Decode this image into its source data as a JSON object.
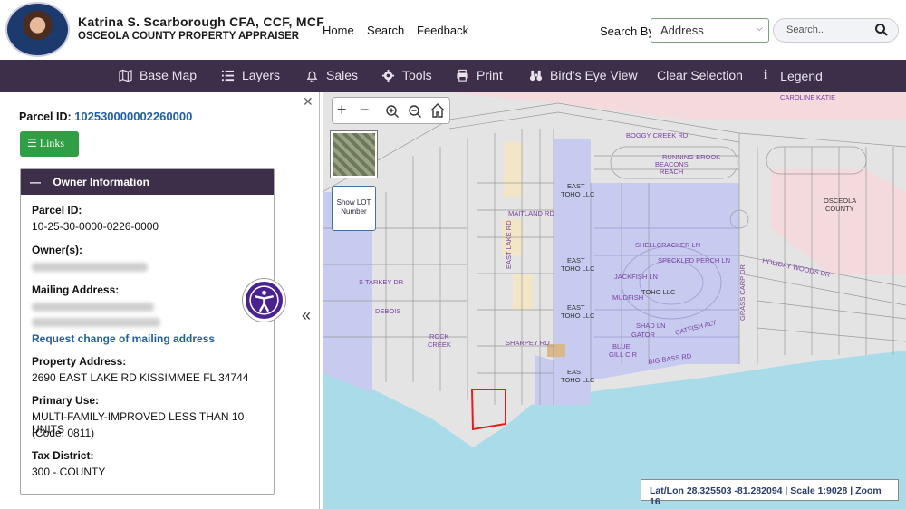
{
  "header": {
    "name": "Katrina S. Scarborough CFA, CCF, MCF",
    "office": "OSCEOLA COUNTY PROPERTY APPRAISER",
    "nav": [
      "Home",
      "Search",
      "Feedback"
    ],
    "search_by_label": "Search By",
    "search_by_value": "Address",
    "search_placeholder": "Search.."
  },
  "toolbar": {
    "items": [
      "Base Map",
      "Layers",
      "Sales",
      "Tools",
      "Print",
      "Bird's Eye View",
      "Clear Selection",
      "Legend"
    ]
  },
  "panel": {
    "parcel_label": "Parcel ID:",
    "parcel_id": "102530000002260000",
    "links_label": "Links",
    "section_title": "Owner Information",
    "parcel_id_label": "Parcel ID:",
    "parcel_id_formatted": "10-25-30-0000-0226-0000",
    "owners_label": "Owner(s):",
    "mailing_label": "Mailing Address:",
    "request_link": "Request change of mailing address",
    "property_label": "Property Address:",
    "property_address": "2690 EAST LAKE RD KISSIMMEE FL 34744",
    "primary_use_label": "Primary Use:",
    "primary_use": "MULTI-FAMILY-IMPROVED LESS THAN 10 UNITS",
    "primary_use_code": "(Code: 0811)",
    "tax_district_label": "Tax District:",
    "tax_district": "300 - COUNTY"
  },
  "map": {
    "lot_button": "Show LOT Number",
    "status": "Lat/Lon 28.325503 -81.282094 | Scale 1:9028 | Zoom 16",
    "labels": {
      "boggy": "BOGGY CREEK RD",
      "maitland": "MAITLAND RD",
      "shellcracker": "SHELLCRACKER LN",
      "speckled": "SPECKLED PERCH LN",
      "jackfish": "JACKFISH LN",
      "holiday": "HOLIDAY WOODS DR",
      "bigbass": "BIG BASS RD",
      "sharpey": "SHARPEY RD",
      "eastlake": "EAST LAKE RD",
      "tarkey": "S TARKEY DR",
      "debois": "DEBOIS",
      "rockcreek1": "ROCK",
      "rockcreek2": "CREEK",
      "east_toho1": "EAST",
      "east_toho2": "TOHO LLC",
      "osceola1": "OSCEOLA",
      "osceola2": "COUNTY",
      "running": "RUNNING BROOK",
      "beacons": "BEACONS",
      "reach": "REACH",
      "mudfish": "MUDFISH",
      "shad": "SHAD LN",
      "gator": "GATOR",
      "blue": "BLUE",
      "gill": "GILL CIR",
      "catfish": "CATFISH ALY",
      "grasscarp": "GRASS CARP DR",
      "caroline": "CAROLINE",
      "katie": "KATIE"
    }
  }
}
